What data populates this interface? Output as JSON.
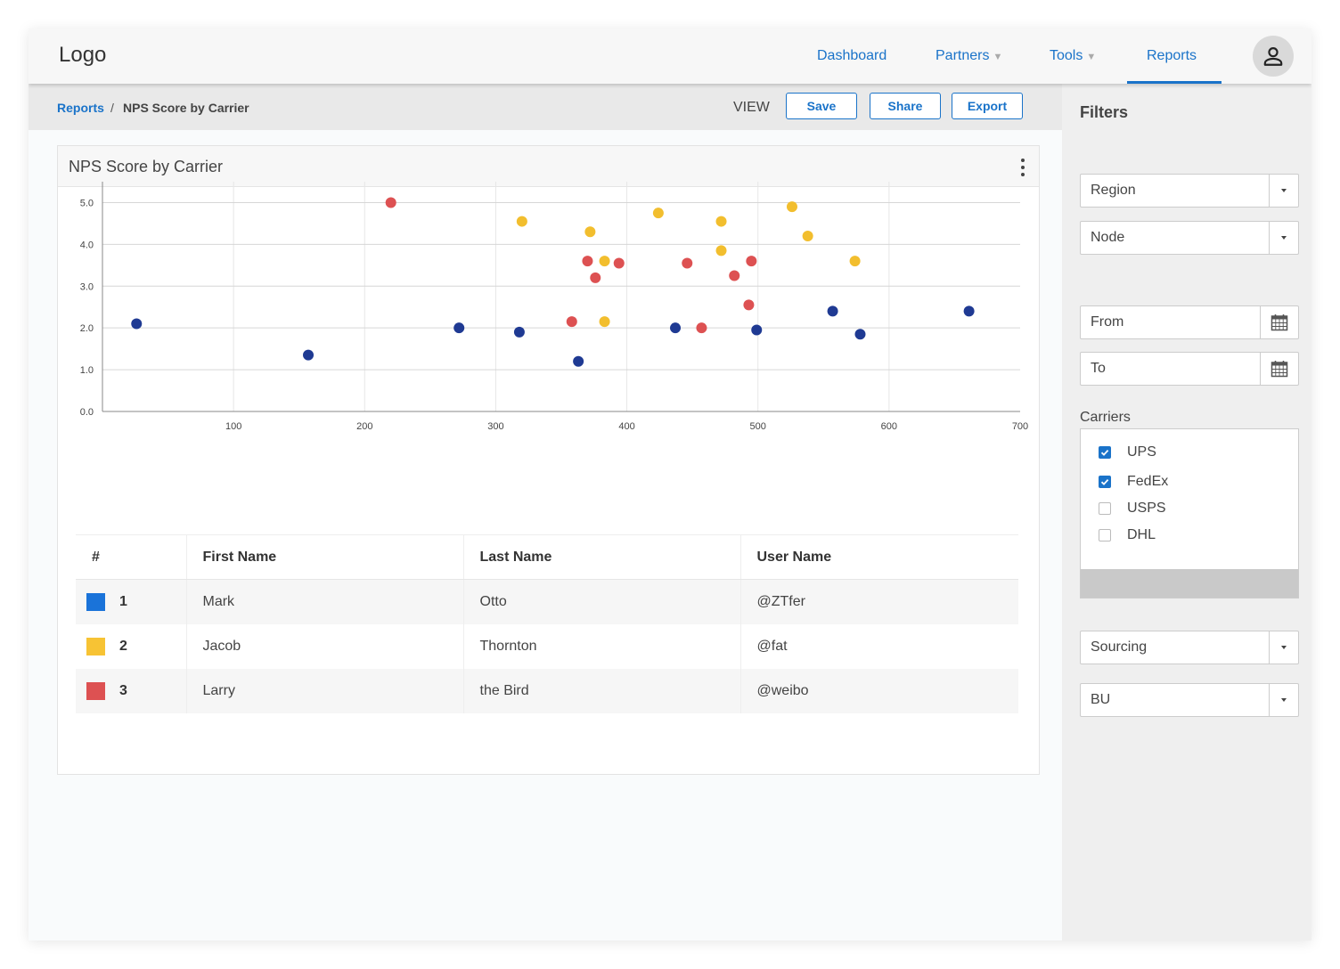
{
  "header": {
    "logo": "Logo",
    "nav": [
      {
        "label": "Dashboard",
        "has_caret": false
      },
      {
        "label": "Partners",
        "has_caret": true
      },
      {
        "label": "Tools",
        "has_caret": true
      },
      {
        "label": "Reports",
        "has_caret": false,
        "active": true
      }
    ],
    "avatar_icon": "user-icon"
  },
  "subbar": {
    "breadcrumb_link": "Reports",
    "breadcrumb_sep": "/",
    "breadcrumb_current": "NPS Score by Carrier",
    "view_label": "VIEW",
    "save_label": "Save",
    "share_label": "Share",
    "export_label": "Export"
  },
  "card": {
    "title": "NPS Score by Carrier"
  },
  "chart_data": {
    "type": "scatter",
    "title": "",
    "xlabel": "",
    "ylabel": "",
    "xlim": [
      0,
      700
    ],
    "ylim": [
      0,
      5.5
    ],
    "x_ticks": [
      100,
      200,
      300,
      400,
      500,
      600,
      700
    ],
    "y_ticks": [
      "0.0",
      "1.0",
      "2.0",
      "3.0",
      "4.0",
      "5.0"
    ],
    "grid": true,
    "series": [
      {
        "color": "#1f3a93",
        "points": [
          [
            26,
            2.1
          ],
          [
            157,
            1.35
          ],
          [
            272,
            2.0
          ],
          [
            318,
            1.9
          ],
          [
            363,
            1.2
          ],
          [
            437,
            2.0
          ],
          [
            499,
            1.95
          ],
          [
            557,
            2.4
          ],
          [
            578,
            1.85
          ],
          [
            661,
            2.4
          ]
        ]
      },
      {
        "color": "#f2be2e",
        "points": [
          [
            320,
            4.55
          ],
          [
            372,
            4.3
          ],
          [
            383,
            3.6
          ],
          [
            383,
            2.15
          ],
          [
            424,
            4.75
          ],
          [
            472,
            4.55
          ],
          [
            472,
            3.85
          ],
          [
            526,
            4.9
          ],
          [
            538,
            4.2
          ],
          [
            574,
            3.6
          ]
        ]
      },
      {
        "color": "#dd5152",
        "points": [
          [
            220,
            5.0
          ],
          [
            358,
            2.15
          ],
          [
            370,
            3.6
          ],
          [
            376,
            3.2
          ],
          [
            394,
            3.55
          ],
          [
            446,
            3.55
          ],
          [
            457,
            2.0
          ],
          [
            482,
            3.25
          ],
          [
            493,
            2.55
          ],
          [
            495,
            3.6
          ]
        ]
      }
    ]
  },
  "table": {
    "headers": [
      "#",
      "First Name",
      "Last Name",
      "User Name"
    ],
    "rows": [
      {
        "num": "1",
        "color": "#1a73d9",
        "first": "Mark",
        "last": "Otto",
        "user": "@ZTfer"
      },
      {
        "num": "2",
        "color": "#f7c334",
        "first": "Jacob",
        "last": "Thornton",
        "user": "@fat"
      },
      {
        "num": "3",
        "color": "#dd5152",
        "first": "Larry",
        "last": "the Bird",
        "user": "@weibo"
      }
    ]
  },
  "filters": {
    "title": "Filters",
    "region": "Region",
    "node": "Node",
    "from_placeholder": "From",
    "to_placeholder": "To",
    "carriers_label": "Carriers",
    "carriers": [
      {
        "label": "UPS",
        "checked": true
      },
      {
        "label": "FedEx",
        "checked": true
      },
      {
        "label": "USPS",
        "checked": false
      },
      {
        "label": "DHL",
        "checked": false
      }
    ],
    "sourcing": "Sourcing",
    "bu": "BU",
    "calendar_icon": "calendar-icon",
    "dropdown_icon": "caret-down-icon"
  }
}
